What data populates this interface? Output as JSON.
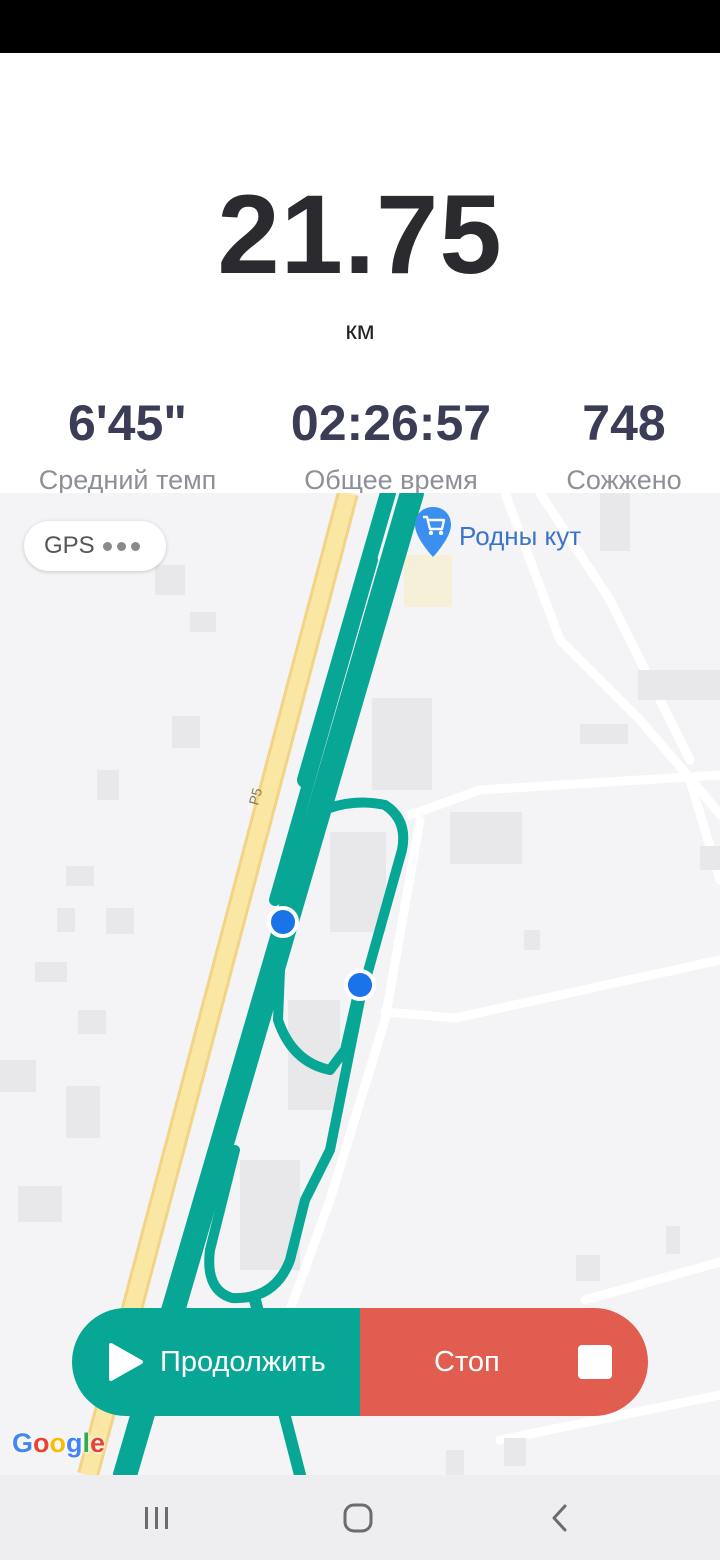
{
  "workout": {
    "distance": "21.75",
    "distance_unit": "км",
    "metrics": [
      {
        "value": "6'45\"",
        "label": "Средний темп"
      },
      {
        "value": "02:26:57",
        "label": "Общее время"
      },
      {
        "value": "748",
        "label": "Сожжено"
      }
    ]
  },
  "map": {
    "gps_label": "GPS",
    "poi_name": "Родны кут",
    "road_label": "Р5",
    "attribution": "Google",
    "route_color": "#08a694",
    "road_color": "#fbe7a4"
  },
  "controls": {
    "resume_label": "Продолжить",
    "stop_label": "Стоп",
    "resume_color": "#08a694",
    "stop_color": "#e05d4f"
  },
  "icons": {
    "resume": "play-icon",
    "stop": "stop-icon",
    "gps_signal": "dots-icon",
    "poi": "shopping-cart-pin-icon"
  },
  "navigation": [
    "recent-apps",
    "home",
    "back"
  ]
}
